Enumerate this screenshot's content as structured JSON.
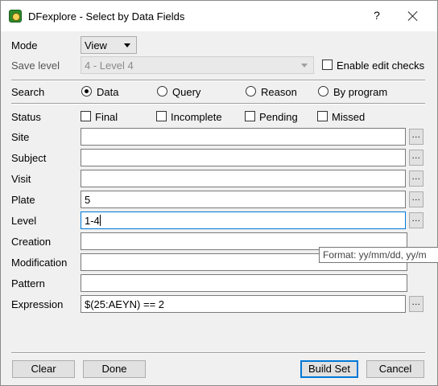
{
  "window": {
    "title": "DFexplore - Select by Data Fields",
    "help_glyph": "?"
  },
  "mode": {
    "label": "Mode",
    "value": "View"
  },
  "save_level": {
    "label": "Save level",
    "value": "4 - Level 4",
    "enable_edit_checks": {
      "label": "Enable edit checks",
      "checked": false
    }
  },
  "search": {
    "label": "Search",
    "options": [
      {
        "label": "Data",
        "selected": true
      },
      {
        "label": "Query",
        "selected": false
      },
      {
        "label": "Reason",
        "selected": false
      },
      {
        "label": "By program",
        "selected": false
      }
    ]
  },
  "status": {
    "label": "Status",
    "options": [
      {
        "label": "Final",
        "checked": false
      },
      {
        "label": "Incomplete",
        "checked": false
      },
      {
        "label": "Pending",
        "checked": false
      },
      {
        "label": "Missed",
        "checked": false
      }
    ]
  },
  "fields": {
    "site": {
      "label": "Site",
      "value": ""
    },
    "subject": {
      "label": "Subject",
      "value": ""
    },
    "visit": {
      "label": "Visit",
      "value": ""
    },
    "plate": {
      "label": "Plate",
      "value": "5"
    },
    "level": {
      "label": "Level",
      "value": "1-4"
    },
    "creation": {
      "label": "Creation",
      "value": ""
    },
    "modification": {
      "label": "Modification",
      "value": ""
    },
    "pattern": {
      "label": "Pattern",
      "value": ""
    },
    "expression": {
      "label": "Expression",
      "value": "$(25:AEYN) == 2"
    }
  },
  "browse_glyph": "...",
  "tooltip": "Format: yy/mm/dd, yy/m",
  "buttons": {
    "clear": "Clear",
    "done": "Done",
    "build_set": "Build Set",
    "cancel": "Cancel"
  }
}
